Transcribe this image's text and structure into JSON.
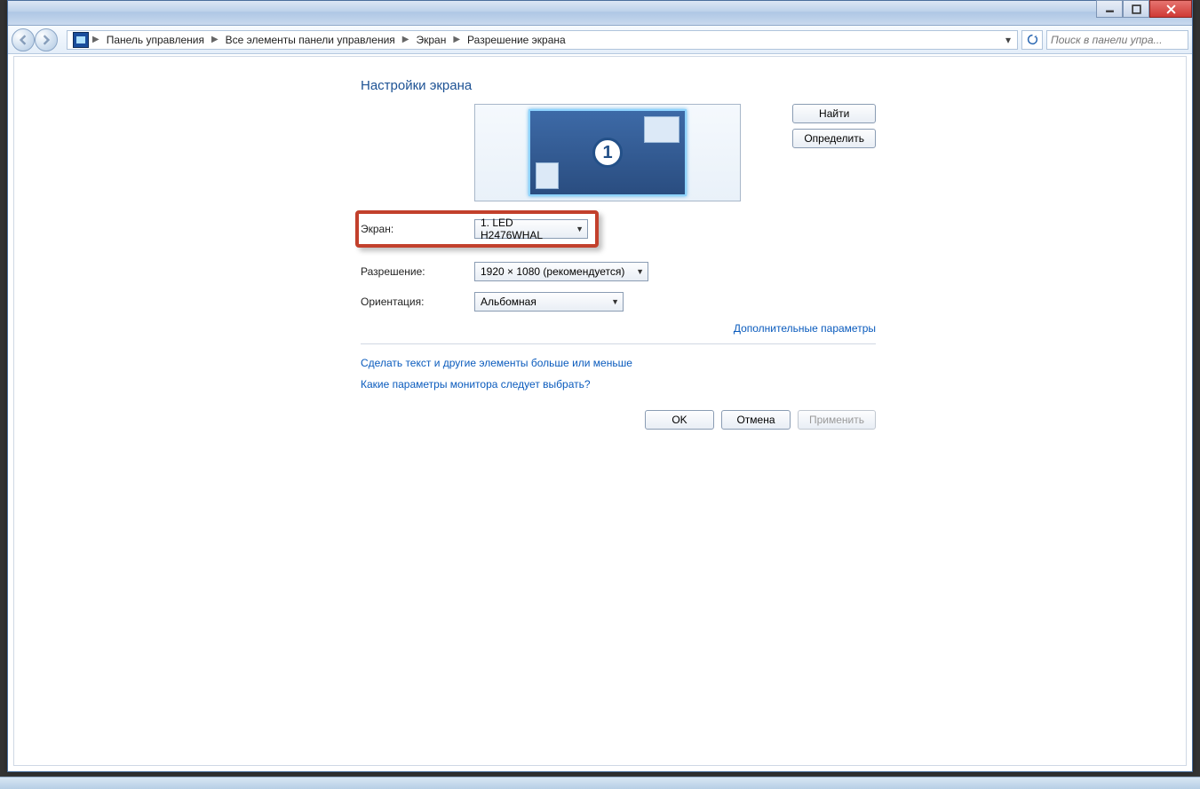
{
  "breadcrumbs": {
    "items": [
      "Панель управления",
      "Все элементы панели управления",
      "Экран",
      "Разрешение экрана"
    ]
  },
  "search": {
    "placeholder": "Поиск в панели упра..."
  },
  "page": {
    "title": "Настройки экрана",
    "monitor_number": "1",
    "find_btn": "Найти",
    "identify_btn": "Определить",
    "screen_label": "Экран:",
    "screen_value": "1. LED H2476WHAL",
    "resolution_label": "Разрешение:",
    "resolution_value": "1920 × 1080 (рекомендуется)",
    "orientation_label": "Ориентация:",
    "orientation_value": "Альбомная",
    "advanced_link": "Дополнительные параметры",
    "help1": "Сделать текст и другие элементы больше или меньше",
    "help2": "Какие параметры монитора следует выбрать?",
    "ok": "OK",
    "cancel": "Отмена",
    "apply": "Применить"
  }
}
